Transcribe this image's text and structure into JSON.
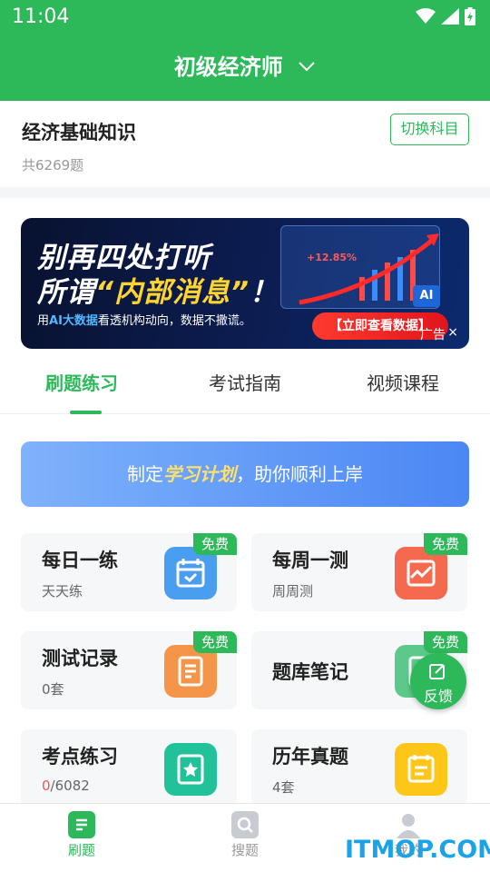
{
  "status": {
    "time": "11:04"
  },
  "header": {
    "title": "初级经济师"
  },
  "subject": {
    "name": "经济基础知识",
    "count": "共6269题",
    "switch_label": "切换科目"
  },
  "ad": {
    "line1": "别再四处打听",
    "line2_pre": "所谓",
    "line2_hl": "“内部消息”",
    "line2_post": "！",
    "sub_pre": "用",
    "sub_ai": "AI大数据",
    "sub_post": "看透机构动向，数据不撒谎。",
    "cta": "【立即查看数据】",
    "panel_value": "+12.85%",
    "chip": "AI",
    "ad_label": "广告",
    "close": "×"
  },
  "tabs": [
    {
      "label": "刷题练习",
      "active": true
    },
    {
      "label": "考试指南",
      "active": false
    },
    {
      "label": "视频课程",
      "active": false
    }
  ],
  "plan": {
    "pre": "制定",
    "hl": "学习计划",
    "post": "，助你顺利上岸"
  },
  "cards": [
    {
      "title": "每日一练",
      "sub": "天天练",
      "free": "免费",
      "icon": "calendar-icon",
      "color": "#4a9ef0"
    },
    {
      "title": "每周一测",
      "sub": "周周测",
      "free": "免费",
      "icon": "chart-icon",
      "color": "#f56a4f"
    },
    {
      "title": "测试记录",
      "sub": "0套",
      "free": "免费",
      "icon": "document-icon",
      "color": "#f5954a"
    },
    {
      "title": "题库笔记",
      "sub": "",
      "free": "免费",
      "icon": "note-icon",
      "color": "#5cc98a"
    },
    {
      "title": "考点练习",
      "sub_done": "0",
      "sub_total": "/6082",
      "icon": "star-book-icon",
      "color": "#21c19a"
    },
    {
      "title": "历年真题",
      "sub": "4套",
      "icon": "list-icon",
      "color": "#ffc61a"
    }
  ],
  "feedback": {
    "label": "反馈"
  },
  "bottom_nav": [
    {
      "label": "刷题",
      "active": true
    },
    {
      "label": "搜题",
      "active": false
    },
    {
      "label": "我的",
      "active": false
    }
  ],
  "watermark": "ITMOP.COM",
  "colors": {
    "brand": "#2db85a",
    "plan": "#4b87f4"
  }
}
